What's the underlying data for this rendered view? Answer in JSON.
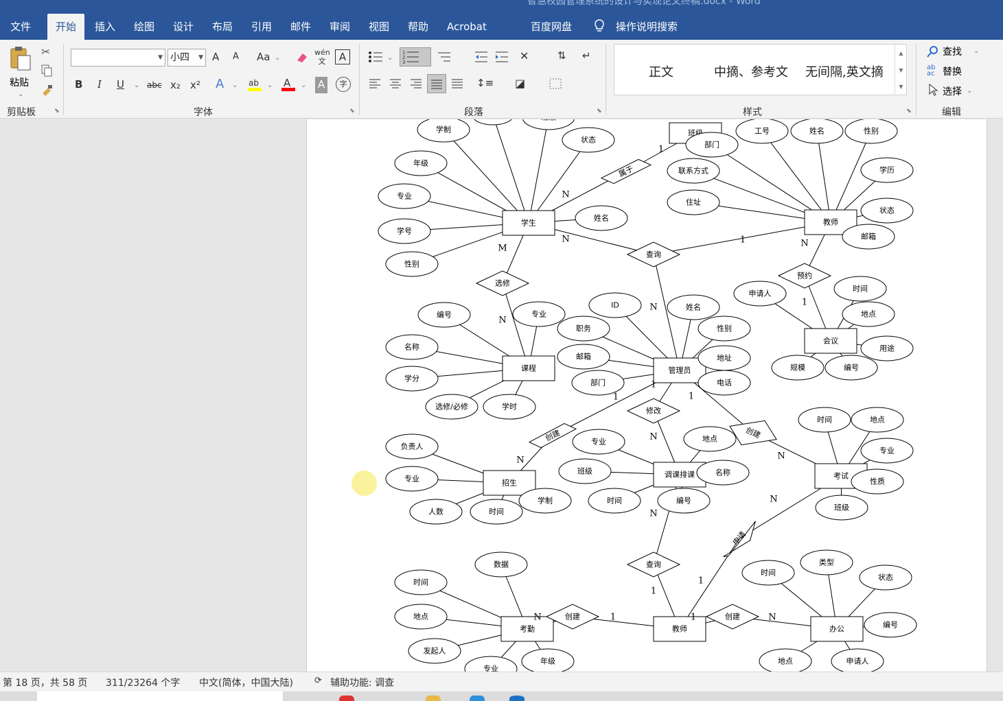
{
  "window": {
    "title": "智慧校园管理系统的设计与实现论文终稿.docx - Word"
  },
  "tabs": [
    "文件",
    "开始",
    "插入",
    "绘图",
    "设计",
    "布局",
    "引用",
    "邮件",
    "审阅",
    "视图",
    "帮助",
    "Acrobat",
    "百度网盘",
    "操作说明搜索"
  ],
  "active_tab": "开始",
  "ribbon": {
    "clipboard": {
      "paste_label": "粘贴",
      "group_label": "剪贴板"
    },
    "font": {
      "font_name": "",
      "font_size": "小四",
      "group_label": "字体",
      "grow": "A",
      "shrink": "A",
      "case": "Aa",
      "bold": "B",
      "italic": "I",
      "underline": "U",
      "strike": "abc",
      "subscript": "x₂",
      "superscript": "x²",
      "phonetic": "wén文",
      "border_char": "A",
      "text_effect": "A",
      "font_color": "A",
      "shading": "A",
      "enclose": "字",
      "highlight_color": "#ffff00",
      "font_color_value": "#ff0000"
    },
    "paragraph": {
      "group_label": "段落"
    },
    "styles": {
      "group_label": "样式",
      "items": [
        "正文",
        "中摘、参考文",
        "无间隔,英文摘"
      ]
    },
    "editing": {
      "group_label": "编辑",
      "find": "查找",
      "replace": "替换",
      "select": "选择"
    }
  },
  "statusbar": {
    "page": "第 18 页，共 58 页",
    "words": "311/23264 个字",
    "language": "中文(简体，中国大陆)",
    "accessibility": "辅助功能: 调查"
  },
  "diagram": {
    "entities": [
      {
        "id": "banji",
        "label": "班级"
      },
      {
        "id": "xuesheng",
        "label": "学生"
      },
      {
        "id": "jiaoshi1",
        "label": "教师"
      },
      {
        "id": "kecheng",
        "label": "课程"
      },
      {
        "id": "guanliyuan",
        "label": "管理员"
      },
      {
        "id": "huiyi",
        "label": "会议"
      },
      {
        "id": "zhaosheng",
        "label": "招生"
      },
      {
        "id": "tiaoke",
        "label": "调课排课"
      },
      {
        "id": "kaoshi",
        "label": "考试"
      },
      {
        "id": "kaoqin",
        "label": "考勤"
      },
      {
        "id": "jiaoshi2",
        "label": "教师"
      },
      {
        "id": "bangong",
        "label": "办公"
      }
    ],
    "relationships": [
      {
        "id": "shuyu",
        "label": "属于"
      },
      {
        "id": "chaxun1",
        "label": "查询"
      },
      {
        "id": "xuanxiu",
        "label": "选修"
      },
      {
        "id": "yuyue",
        "label": "预约"
      },
      {
        "id": "xiugai",
        "label": "修改"
      },
      {
        "id": "chuangjian1",
        "label": "创建"
      },
      {
        "id": "chuangjian2",
        "label": "创建"
      },
      {
        "id": "shenqing",
        "label": "申请"
      },
      {
        "id": "chaxun2",
        "label": "查询"
      },
      {
        "id": "chuangjian3",
        "label": "创建"
      },
      {
        "id": "chuangjian4",
        "label": "创建"
      }
    ],
    "attributes": [
      {
        "id": "xs_xuezhi",
        "label": "学制"
      },
      {
        "id": "xs_hidden",
        "label": ""
      },
      {
        "id": "xs_banji",
        "label": "班级"
      },
      {
        "id": "xs_zhuangtai",
        "label": "状态"
      },
      {
        "id": "xs_nianji",
        "label": "年级"
      },
      {
        "id": "xs_zhuanye",
        "label": "专业"
      },
      {
        "id": "xs_xuehao",
        "label": "学号"
      },
      {
        "id": "xs_xingbie",
        "label": "性别"
      },
      {
        "id": "xs_xingming",
        "label": "姓名"
      },
      {
        "id": "js_bumen",
        "label": "部门"
      },
      {
        "id": "js_gonghao",
        "label": "工号"
      },
      {
        "id": "js_xingming",
        "label": "姓名"
      },
      {
        "id": "js_xingbie",
        "label": "性别"
      },
      {
        "id": "js_lianxi",
        "label": "联系方式"
      },
      {
        "id": "js_xueli",
        "label": "学历"
      },
      {
        "id": "js_zhuzhi",
        "label": "住址"
      },
      {
        "id": "js_zhuangtai",
        "label": "状态"
      },
      {
        "id": "js_youxiang",
        "label": "邮箱"
      },
      {
        "id": "kc_bianhao",
        "label": "编号"
      },
      {
        "id": "kc_zhuanye",
        "label": "专业"
      },
      {
        "id": "kc_mingcheng",
        "label": "名称"
      },
      {
        "id": "kc_xuefen",
        "label": "学分"
      },
      {
        "id": "kc_xuanxiu",
        "label": "选修/必修"
      },
      {
        "id": "kc_xueshi",
        "label": "学时"
      },
      {
        "id": "gl_id",
        "label": "ID"
      },
      {
        "id": "gl_xingming",
        "label": "姓名"
      },
      {
        "id": "gl_zhiwu",
        "label": "职务"
      },
      {
        "id": "gl_xingbie",
        "label": "性别"
      },
      {
        "id": "gl_youxiang",
        "label": "邮箱"
      },
      {
        "id": "gl_dizhi",
        "label": "地址"
      },
      {
        "id": "gl_bumen",
        "label": "部门"
      },
      {
        "id": "gl_dianhua",
        "label": "电话"
      },
      {
        "id": "hy_shenqingren",
        "label": "申请人"
      },
      {
        "id": "hy_shijian",
        "label": "时间"
      },
      {
        "id": "hy_didian",
        "label": "地点"
      },
      {
        "id": "hy_yongtu",
        "label": "用途"
      },
      {
        "id": "hy_guimo",
        "label": "规模"
      },
      {
        "id": "hy_bianhao",
        "label": "编号"
      },
      {
        "id": "zs_fuzeren",
        "label": "负责人"
      },
      {
        "id": "zs_zhuanye",
        "label": "专业"
      },
      {
        "id": "zs_renshu",
        "label": "人数"
      },
      {
        "id": "zs_shijian",
        "label": "时间"
      },
      {
        "id": "zs_xuezhi",
        "label": "学制"
      },
      {
        "id": "tk_zhuanye",
        "label": "专业"
      },
      {
        "id": "tk_didian",
        "label": "地点"
      },
      {
        "id": "tk_banji",
        "label": "班级"
      },
      {
        "id": "tk_mingcheng",
        "label": "名称"
      },
      {
        "id": "tk_shijian",
        "label": "时间"
      },
      {
        "id": "tk_bianhao",
        "label": "编号"
      },
      {
        "id": "ks_shijian",
        "label": "时间"
      },
      {
        "id": "ks_didian",
        "label": "地点"
      },
      {
        "id": "ks_zhuanye",
        "label": "专业"
      },
      {
        "id": "ks_xingzhi",
        "label": "性质"
      },
      {
        "id": "ks_banji",
        "label": "班级"
      },
      {
        "id": "kq_shuju",
        "label": "数据"
      },
      {
        "id": "kq_shijian",
        "label": "时间"
      },
      {
        "id": "kq_didian",
        "label": "地点"
      },
      {
        "id": "kq_faqiren",
        "label": "发起人"
      },
      {
        "id": "kq_zhuanye",
        "label": "专业"
      },
      {
        "id": "kq_nianji",
        "label": "年级"
      },
      {
        "id": "bg_leixing",
        "label": "类型"
      },
      {
        "id": "bg_shijian",
        "label": "时间"
      },
      {
        "id": "bg_zhuangtai",
        "label": "状态"
      },
      {
        "id": "bg_bianhao",
        "label": "编号"
      },
      {
        "id": "bg_didian",
        "label": "地点"
      },
      {
        "id": "bg_shenqingren",
        "label": "申请人"
      }
    ],
    "cardinalities": [
      {
        "id": "c_banji_shuyu",
        "label": "1"
      },
      {
        "id": "c_xs_shuyu",
        "label": "N"
      },
      {
        "id": "c_xs_chaxun",
        "label": "N"
      },
      {
        "id": "c_js_chaxun",
        "label": "1"
      },
      {
        "id": "c_gl_chaxun",
        "label": "N"
      },
      {
        "id": "c_xs_xuanxiu",
        "label": "M"
      },
      {
        "id": "c_kc_xuanxiu",
        "label": "N"
      },
      {
        "id": "c_js_yuyue",
        "label": "N"
      },
      {
        "id": "c_hy_yuyue",
        "label": "1"
      },
      {
        "id": "c_gl_xiugai",
        "label": "1"
      },
      {
        "id": "c_tk_xiugai",
        "label": "N"
      },
      {
        "id": "c_gl_cj1",
        "label": "1"
      },
      {
        "id": "c_zs_cj1",
        "label": "N"
      },
      {
        "id": "c_gl_cj2",
        "label": "1"
      },
      {
        "id": "c_ks_cj2",
        "label": "N"
      },
      {
        "id": "c_ks_sq",
        "label": "N"
      },
      {
        "id": "c_js2_sq",
        "label": "1"
      },
      {
        "id": "c_tk_cx2",
        "label": "N"
      },
      {
        "id": "c_js2_cx2",
        "label": "1"
      },
      {
        "id": "c_kq_cj3",
        "label": "N"
      },
      {
        "id": "c_js2_cj3",
        "label": "1"
      },
      {
        "id": "c_js2_cj4",
        "label": "1"
      },
      {
        "id": "c_bg_cj4",
        "label": "N"
      }
    ]
  }
}
